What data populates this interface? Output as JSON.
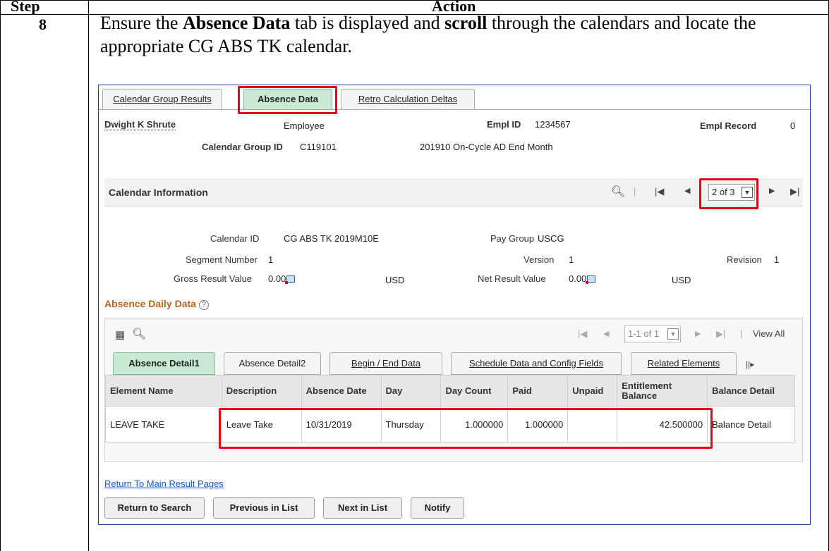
{
  "doc": {
    "header_step": "Step",
    "header_action": "Action",
    "step_number": "8",
    "instruction": {
      "t1": "Ensure the ",
      "b1": "Absence Data",
      "t2": " tab is displayed and ",
      "b2": "scroll",
      "t3": " through the calendars and locate the appropriate CG ABS TK calendar."
    }
  },
  "app": {
    "tabs": [
      {
        "label": "Calendar Group Results"
      },
      {
        "label": "Absence Data"
      },
      {
        "label": "Retro Calculation Deltas"
      }
    ],
    "employee": {
      "name": "Dwight K Shrute",
      "type": "Employee",
      "empl_id_label": "Empl ID",
      "empl_id": "1234567",
      "empl_record_label": "Empl Record",
      "empl_record": "0",
      "cal_group_label": "Calendar Group ID",
      "cal_group_id": "C119101",
      "cal_group_desc": "201910 On-Cycle AD End Month"
    },
    "calendar_info": {
      "title": "Calendar Information",
      "pager": "2 of 3",
      "calendar_id_label": "Calendar ID",
      "calendar_id": "CG ABS TK 2019M10E",
      "pay_group_label": "Pay Group",
      "pay_group": "USCG",
      "segment_label": "Segment Number",
      "segment": "1",
      "version_label": "Version",
      "version": "1",
      "revision_label": "Revision",
      "revision": "1",
      "gross_label": "Gross Result Value",
      "gross_value": "0.00",
      "gross_currency": "USD",
      "net_label": "Net Result Value",
      "net_value": "0.00",
      "net_currency": "USD"
    },
    "absence_daily": {
      "title": "Absence Daily Data",
      "pager": "1-1 of 1",
      "view_all": "View All",
      "subtabs": [
        {
          "label": "Absence Detail1"
        },
        {
          "label": "Absence Detail2"
        },
        {
          "label": "Begin / End Data"
        },
        {
          "label": "Schedule Data and Config Fields"
        },
        {
          "label": "Related Elements"
        }
      ],
      "columns": [
        "Element Name",
        "Description",
        "Absence Date",
        "Day",
        "Day Count",
        "Paid",
        "Unpaid",
        "Entitlement Balance",
        "Balance Detail"
      ],
      "row": {
        "element_name": "LEAVE TAKE",
        "description": "Leave Take",
        "absence_date": "10/31/2019",
        "day": "Thursday",
        "day_count": "1.000000",
        "paid": "1.000000",
        "unpaid": "",
        "entitlement_balance": "42.500000",
        "balance_detail": "Balance Detail"
      }
    },
    "return_link": "Return To Main Result Pages",
    "buttons": {
      "return_search": "Return to Search",
      "previous": "Previous in List",
      "next": "Next in List",
      "notify": "Notify"
    },
    "highlight_color": "#e30613",
    "active_tab_color": "#c9e9d3"
  }
}
